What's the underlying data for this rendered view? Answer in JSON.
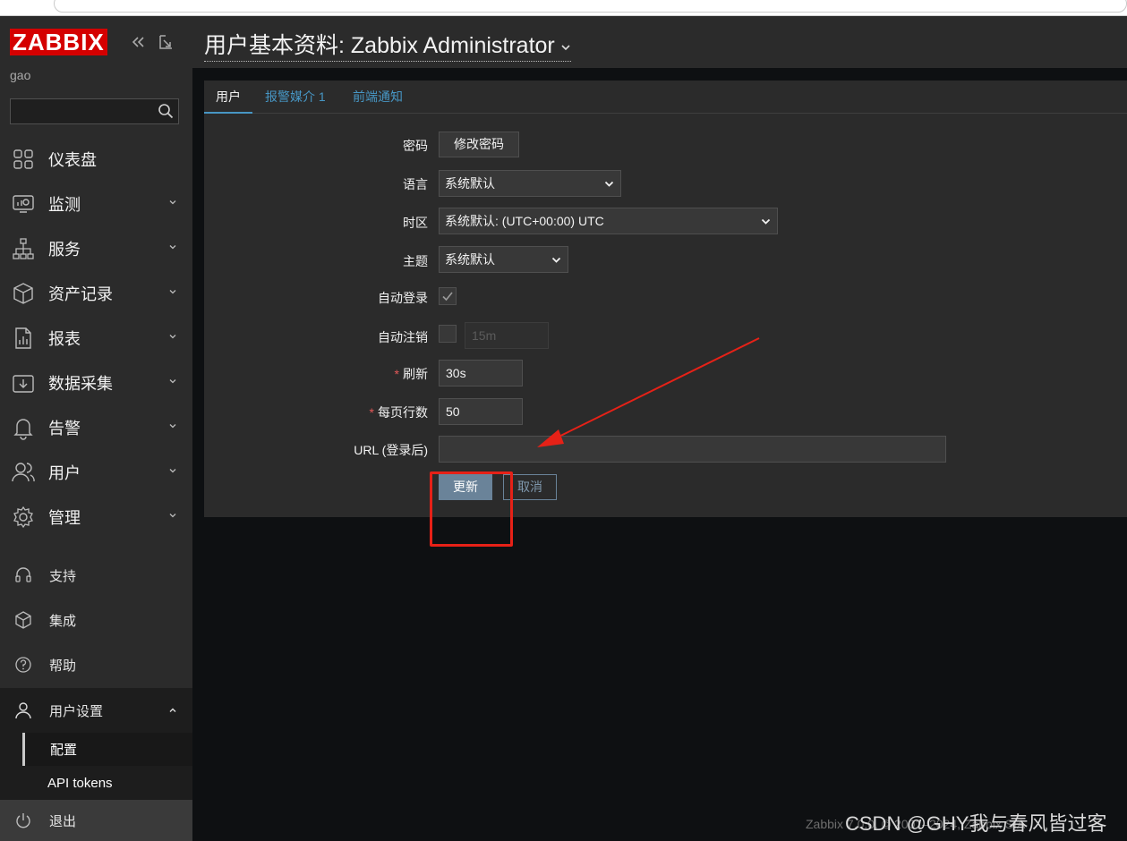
{
  "sidebar": {
    "logo": "ZABBIX",
    "server_name": "gao",
    "search": {
      "value": "",
      "placeholder": ""
    },
    "menu": [
      {
        "label": "仪表盘",
        "icon": "dashboard-icon"
      },
      {
        "label": "监测",
        "icon": "monitoring-icon"
      },
      {
        "label": "服务",
        "icon": "services-icon"
      },
      {
        "label": "资产记录",
        "icon": "inventory-icon"
      },
      {
        "label": "报表",
        "icon": "reports-icon"
      },
      {
        "label": "数据采集",
        "icon": "data-collection-icon"
      },
      {
        "label": "告警",
        "icon": "alerts-icon"
      },
      {
        "label": "用户",
        "icon": "users-icon"
      },
      {
        "label": "管理",
        "icon": "administration-icon"
      }
    ],
    "support_label": "支持",
    "integrations_label": "集成",
    "help_label": "帮助",
    "user_settings_label": "用户设置",
    "user_settings_items": [
      {
        "label": "配置"
      },
      {
        "label": "API tokens"
      }
    ],
    "signout_label": "退出"
  },
  "header": {
    "title": "用户基本资料: Zabbix Administrator"
  },
  "tabs": [
    {
      "label": "用户"
    },
    {
      "label": "报警媒介 1"
    },
    {
      "label": "前端通知"
    }
  ],
  "form": {
    "password": {
      "label": "密码",
      "button": "修改密码"
    },
    "language": {
      "label": "语言",
      "value": "系统默认"
    },
    "timezone": {
      "label": "时区",
      "value": "系统默认: (UTC+00:00) UTC"
    },
    "theme": {
      "label": "主题",
      "value": "系统默认"
    },
    "autologin": {
      "label": "自动登录",
      "checked": true
    },
    "autologout": {
      "label": "自动注销",
      "checked": false,
      "value": "15m"
    },
    "refresh": {
      "label": "刷新",
      "required_mark": "*",
      "value": "30s"
    },
    "rows_per_page": {
      "label": "每页行数",
      "required_mark": "*",
      "value": "50"
    },
    "url": {
      "label": "URL (登录后)",
      "value": ""
    },
    "update_button": "更新",
    "cancel_button": "取消"
  },
  "footer": {
    "text": "Zabbix 7.0.0. © 2001–2024, Zabbix SIA"
  },
  "watermark": "CSDN @GHY我与春风皆过客",
  "colors": {
    "brand_red": "#d40000",
    "link_blue": "#4796c4",
    "primary_button": "#6a8399",
    "annotation_red": "#e62117"
  }
}
